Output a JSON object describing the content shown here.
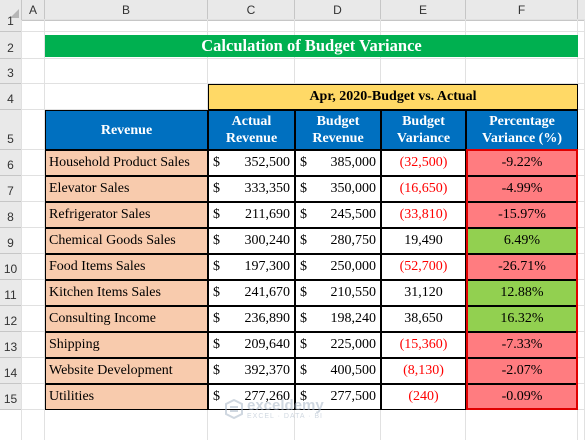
{
  "sheet": {
    "columns": [
      "A",
      "B",
      "C",
      "D",
      "E",
      "F"
    ],
    "rows": [
      "1",
      "2",
      "3",
      "4",
      "5",
      "6",
      "7",
      "8",
      "9",
      "10",
      "11",
      "12",
      "13",
      "14",
      "15"
    ]
  },
  "title": "Calculation of Budget Variance",
  "table": {
    "group_header": "Apr, 2020-Budget vs. Actual",
    "headers": [
      "Revenue",
      "Actual Revenue",
      "Budget Revenue",
      "Budget Variance",
      "Percentage Variance (%)"
    ],
    "currency_symbol": "$",
    "rows": [
      {
        "name": "Household Product Sales",
        "actual": "352,500",
        "budget": "385,000",
        "variance": "(32,500)",
        "pct": "-9.22%",
        "negative": true
      },
      {
        "name": "Elevator Sales",
        "actual": "333,350",
        "budget": "350,000",
        "variance": "(16,650)",
        "pct": "-4.99%",
        "negative": true
      },
      {
        "name": "Refrigerator Sales",
        "actual": "211,690",
        "budget": "245,500",
        "variance": "(33,810)",
        "pct": "-15.97%",
        "negative": true
      },
      {
        "name": "Chemical Goods Sales",
        "actual": "300,240",
        "budget": "280,750",
        "variance": "19,490",
        "pct": "6.49%",
        "negative": false
      },
      {
        "name": "Food Items Sales",
        "actual": "197,300",
        "budget": "250,000",
        "variance": "(52,700)",
        "pct": "-26.71%",
        "negative": true
      },
      {
        "name": "Kitchen Items Sales",
        "actual": "241,670",
        "budget": "210,550",
        "variance": "31,120",
        "pct": "12.88%",
        "negative": false
      },
      {
        "name": "Consulting Income",
        "actual": "236,890",
        "budget": "198,240",
        "variance": "38,650",
        "pct": "16.32%",
        "negative": false
      },
      {
        "name": "Shipping",
        "actual": "209,640",
        "budget": "225,000",
        "variance": "(15,360)",
        "pct": "-7.33%",
        "negative": true
      },
      {
        "name": "Website Development",
        "actual": "392,370",
        "budget": "400,500",
        "variance": "(8,130)",
        "pct": "-2.07%",
        "negative": true
      },
      {
        "name": "Utilities",
        "actual": "277,260",
        "budget": "277,500",
        "variance": "(240)",
        "pct": "-0.09%",
        "negative": true
      }
    ]
  },
  "watermark": {
    "name": "exceldemy",
    "tagline": "EXCEL · DATA · BI"
  },
  "colors": {
    "title_bg": "#00b050",
    "group_header_bg": "#ffd966",
    "header_bg": "#0070c0",
    "revenue_bg": "#f8cbad",
    "negative_pct_bg": "#ff7c80",
    "positive_pct_bg": "#92d050",
    "negative_text": "#ff0000",
    "highlight_border": "#e00000"
  }
}
